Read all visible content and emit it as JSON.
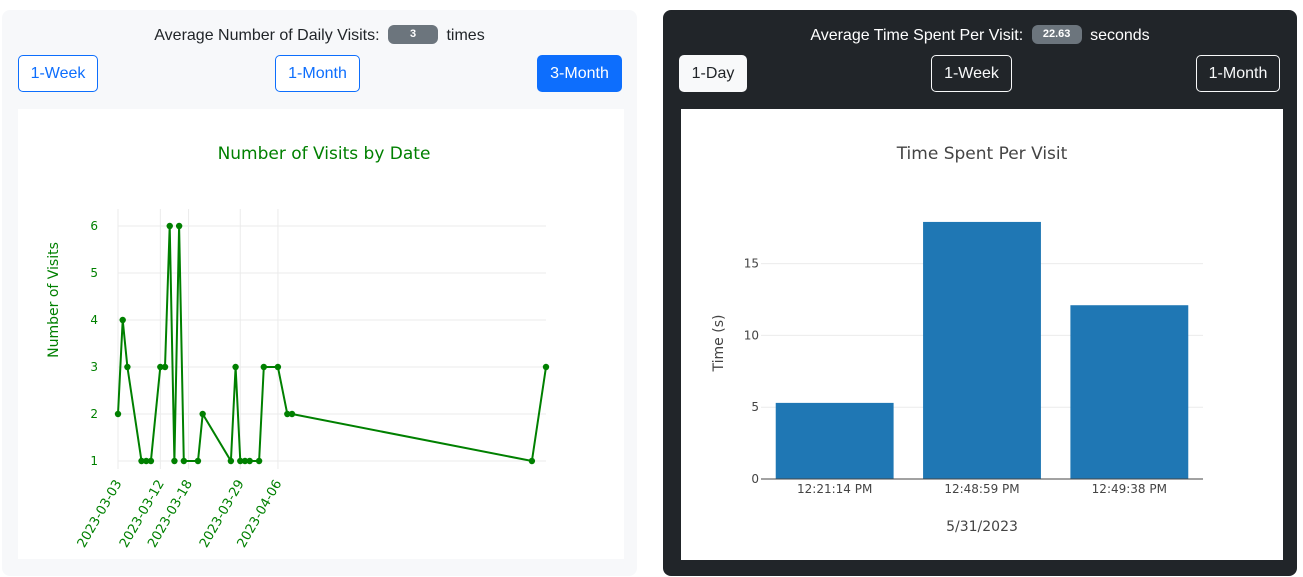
{
  "visits_panel": {
    "label": "Average Number of Daily Visits:",
    "value": "3",
    "unit": "times",
    "buttons": [
      "1-Week",
      "1-Month",
      "3-Month"
    ],
    "active_button": "3-Month"
  },
  "time_panel": {
    "label": "Average Time Spent Per Visit:",
    "value": "22.63",
    "unit": "seconds",
    "buttons": [
      "1-Day",
      "1-Week",
      "1-Month"
    ],
    "active_button": "1-Day"
  },
  "chart_data": [
    {
      "type": "line",
      "title": "Number of Visits by Date",
      "xlabel": "",
      "ylabel": "Number of Visits",
      "color": "#008000",
      "markers": true,
      "x": [
        "2023-03-03",
        "2023-03-04",
        "2023-03-05",
        "2023-03-08",
        "2023-03-09",
        "2023-03-10",
        "2023-03-12",
        "2023-03-13",
        "2023-03-14",
        "2023-03-15",
        "2023-03-16",
        "2023-03-17",
        "2023-03-20",
        "2023-03-21",
        "2023-03-27",
        "2023-03-28",
        "2023-03-29",
        "2023-03-30",
        "2023-03-31",
        "2023-04-02",
        "2023-04-03",
        "2023-04-06",
        "2023-04-08",
        "2023-04-09",
        "2023-05-30",
        "2023-06-02"
      ],
      "y": [
        2,
        4,
        3,
        1,
        1,
        1,
        3,
        3,
        6,
        1,
        6,
        1,
        1,
        2,
        1,
        3,
        1,
        1,
        1,
        1,
        3,
        3,
        2,
        2,
        1,
        3
      ],
      "xticks": [
        "2023-03-03",
        "2023-03-12",
        "2023-03-18",
        "2023-03-29",
        "2023-04-06"
      ],
      "yticks": [
        1,
        2,
        3,
        4,
        5,
        6
      ],
      "grid": true
    },
    {
      "type": "bar",
      "title": "Time Spent Per Visit",
      "xlabel": "5/31/2023",
      "ylabel": "Time (s)",
      "color": "#1f77b4",
      "categories": [
        "12:21:14 PM",
        "12:48:59 PM",
        "12:49:38 PM"
      ],
      "values": [
        5.3,
        17.9,
        12.1
      ],
      "yticks": [
        0,
        5,
        10,
        15
      ],
      "ylim": [
        0,
        18.8
      ],
      "grid": true
    }
  ]
}
